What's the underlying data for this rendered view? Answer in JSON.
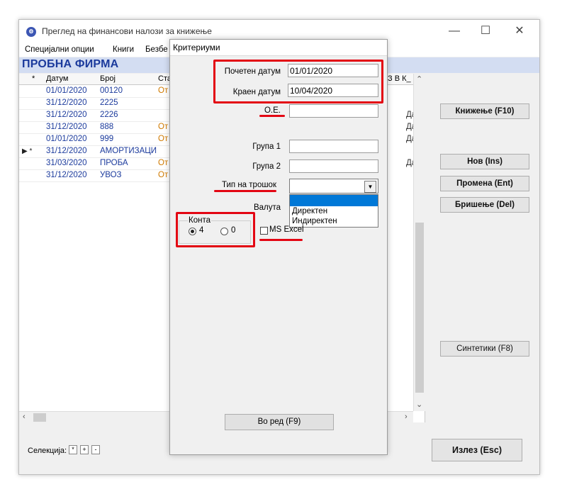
{
  "window": {
    "title": "Преглед на финансови налози за книжење",
    "controls": {
      "minimize": "—",
      "maximize": "☐",
      "close": "✕"
    }
  },
  "menu": [
    "Специјални опции",
    "Книги",
    "Безбе"
  ],
  "company": "ПРОБНА ФИРМА",
  "grid": {
    "headers": {
      "star": "*",
      "date": "Датум",
      "number": "Број",
      "status": "Ста",
      "right": "З В К_"
    },
    "rows": [
      {
        "marker": "",
        "date": "01/01/2020",
        "number": "00120",
        "status": "От",
        "k": ""
      },
      {
        "marker": "",
        "date": "31/12/2020",
        "number": "2225",
        "status": "",
        "k": ""
      },
      {
        "marker": "",
        "date": "31/12/2020",
        "number": "2226",
        "status": "",
        "k": "Да"
      },
      {
        "marker": "",
        "date": "31/12/2020",
        "number": "888",
        "status": "От",
        "k": "Да"
      },
      {
        "marker": "",
        "date": "01/01/2020",
        "number": "999",
        "status": "От",
        "k": "Да"
      },
      {
        "marker": "▶ *",
        "date": "31/12/2020",
        "number": "АМОРТИЗАЦИ",
        "status": "",
        "k": ""
      },
      {
        "marker": "",
        "date": "31/03/2020",
        "number": "ПРОБА",
        "status": "От",
        "k": "Да"
      },
      {
        "marker": "",
        "date": "31/12/2020",
        "number": "УВОЗ",
        "status": "От",
        "k": ""
      }
    ]
  },
  "right_buttons": {
    "book": "Книжење (F10)",
    "new": "Нов (Ins)",
    "edit": "Промена (Ent)",
    "delete": "Бришење (Del)",
    "synthetic": "Синтетики (F8)",
    "exit": "Излез (Esc)"
  },
  "selection": {
    "label": "Селекција:",
    "buttons": [
      "*",
      "+",
      "-"
    ]
  },
  "dialog": {
    "title": "Критериуми",
    "start_date_label": "Почетен датум",
    "start_date_value": "01/01/2020",
    "end_date_label": "Краен датум",
    "end_date_value": "10/04/2020",
    "oe_label": "О.Е.",
    "group1_label": "Група 1",
    "group2_label": "Група 2",
    "cost_type_label": "Тип на трошок",
    "currency_label": "Валута",
    "cost_type_options": [
      "",
      "Директен",
      "Индиректен"
    ],
    "accounts_label": "Конта",
    "radio_4": "4",
    "radio_0": "0",
    "excel_label": "MS Excel",
    "ok_button": "Во ред  (F9)"
  },
  "colors": {
    "annotation": "#e30613",
    "grid_text": "#1b3a9c",
    "selection": "#0078d7"
  }
}
